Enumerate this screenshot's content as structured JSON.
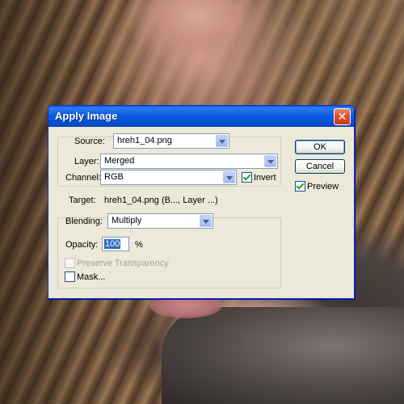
{
  "dialog": {
    "title": "Apply Image",
    "source": {
      "label": "Source:",
      "value": "hreh1_04.png"
    },
    "layer": {
      "label": "Layer:",
      "value": "Merged"
    },
    "channel": {
      "label": "Channel:",
      "value": "RGB",
      "invert_label": "Invert",
      "invert_checked": true
    },
    "target": {
      "label": "Target:",
      "value": "hreh1_04.png (B..., Layer ...)"
    },
    "blending": {
      "label": "Blending:",
      "value": "Multiply"
    },
    "opacity": {
      "label": "Opacity:",
      "value": "100",
      "unit": "%"
    },
    "preserve_transparency": {
      "label": "Preserve Transparency",
      "checked": false,
      "enabled": false
    },
    "mask": {
      "label": "Mask...",
      "checked": false
    },
    "buttons": {
      "ok": "OK",
      "cancel": "Cancel"
    },
    "preview": {
      "label": "Preview",
      "checked": true
    },
    "close_glyph": "✕"
  },
  "colors": {
    "titlebar_blue": "#0551d3",
    "dialog_face": "#ece9d8",
    "close_red": "#d6502c"
  }
}
